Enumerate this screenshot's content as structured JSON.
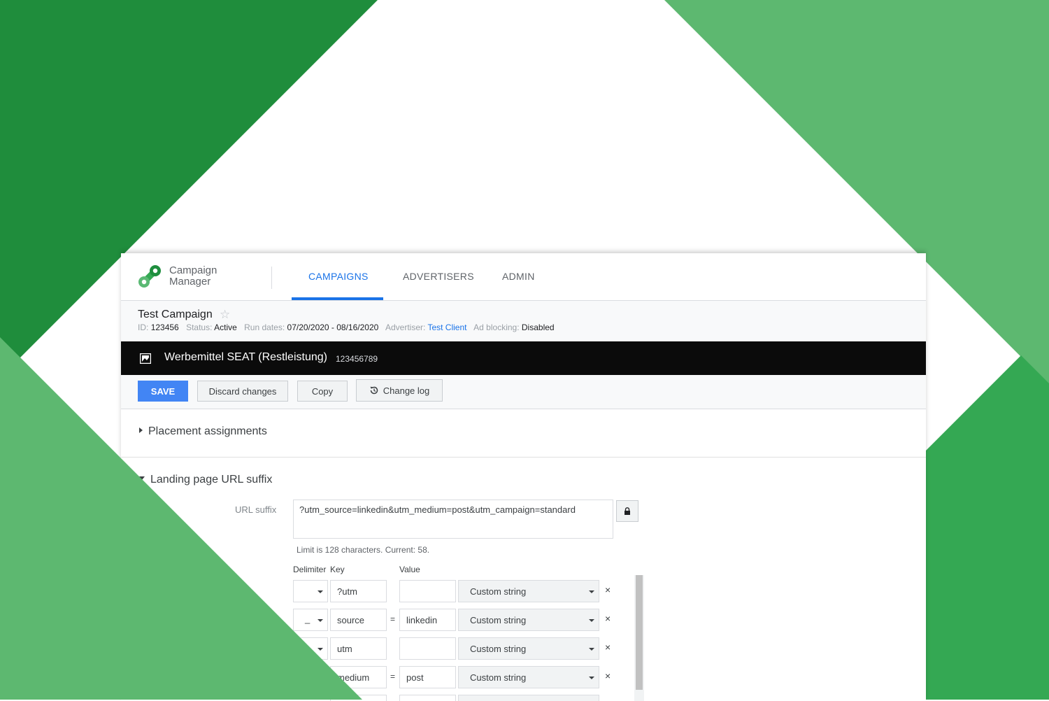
{
  "colors": {
    "accent": "#1a73e8",
    "primary_button": "#4285f4",
    "green_dark": "#1f8d3c",
    "green_mid": "#34a853",
    "green_light": "#5db870"
  },
  "app": {
    "brand_line1": "Campaign",
    "brand_line2": "Manager",
    "logo_icon": "campaign-manager-logo",
    "nav_tabs": [
      {
        "label": "CAMPAIGNS",
        "active": true
      },
      {
        "label": "ADVERTISERS",
        "active": false
      },
      {
        "label": "ADMIN",
        "active": false
      }
    ]
  },
  "campaign": {
    "title": "Test Campaign",
    "star_icon": "star-outline-icon",
    "id_label": "ID:",
    "id": "123456",
    "status_label": "Status:",
    "status": "Active",
    "run_dates_label": "Run dates:",
    "run_dates": "07/20/2020 - 08/16/2020",
    "advertiser_label": "Advertiser:",
    "advertiser": "Test Client",
    "ad_blocking_label": "Ad blocking:",
    "ad_blocking": "Disabled"
  },
  "creative": {
    "icon": "image-icon",
    "title": "Werbemittel SEAT (Restleistung)",
    "id": "123456789"
  },
  "actions": {
    "save": "SAVE",
    "discard": "Discard changes",
    "copy": "Copy",
    "change_log": "Change log",
    "change_log_icon": "history-icon"
  },
  "sections": {
    "placement": "Placement assignments",
    "landing": "Landing page URL suffix"
  },
  "url_suffix": {
    "label": "URL suffix",
    "value": "?utm_source=linkedin&utm_medium=post&utm_campaign=standard",
    "lock_icon": "lock-icon",
    "limit_text": "Limit is 128 characters. Current: 58."
  },
  "params": {
    "col_delimiter": "Delimiter",
    "col_key": "Key",
    "col_value": "Value",
    "rows": [
      {
        "delimiter": "",
        "key": "?utm",
        "eq": "",
        "value": "",
        "type": "Custom string",
        "remove": "×"
      },
      {
        "delimiter": "_",
        "key": "source",
        "eq": "=",
        "value": "linkedin",
        "type": "Custom string",
        "remove": "×"
      },
      {
        "delimiter": "",
        "key": "utm",
        "eq": "",
        "value": "",
        "type": "Custom string",
        "remove": "×"
      },
      {
        "delimiter": "",
        "key": "medium",
        "eq": "=",
        "value": "post",
        "type": "Custom string",
        "remove": "×"
      }
    ]
  }
}
